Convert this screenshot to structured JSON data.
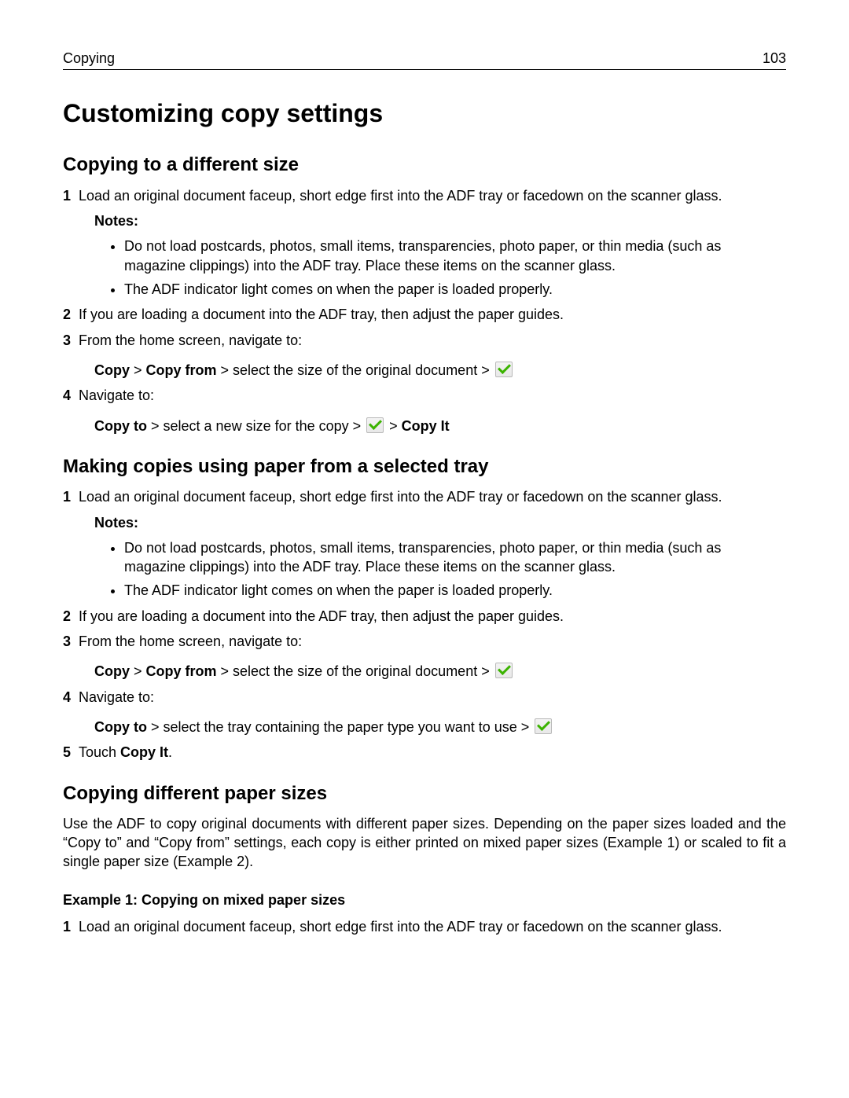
{
  "header": {
    "left": "Copying",
    "right": "103"
  },
  "title": "Customizing copy settings",
  "sectionA": {
    "heading": "Copying to a different size",
    "step1": "Load an original document faceup, short edge first into the ADF tray or facedown on the scanner glass.",
    "notesLabel": "Notes:",
    "note1": "Do not load postcards, photos, small items, transparencies, photo paper, or thin media (such as magazine clippings) into the ADF tray. Place these items on the scanner glass.",
    "note2": "The ADF indicator light comes on when the paper is loaded properly.",
    "step2": "If you are loading a document into the ADF tray, then adjust the paper guides.",
    "step3": "From the home screen, navigate to:",
    "path3_a": "Copy",
    "path3_gt1": " > ",
    "path3_b": "Copy from",
    "path3_rest": " > select the size of the original document > ",
    "step4": "Navigate to:",
    "path4_a": "Copy to",
    "path4_rest": " > select a new size for the copy > ",
    "path4_gt2": " > ",
    "path4_end": "Copy It"
  },
  "sectionB": {
    "heading": "Making copies using paper from a selected tray",
    "step1": "Load an original document faceup, short edge first into the ADF tray or facedown on the scanner glass.",
    "notesLabel": "Notes:",
    "note1": "Do not load postcards, photos, small items, transparencies, photo paper, or thin media (such as magazine clippings) into the ADF tray. Place these items on the scanner glass.",
    "note2": "The ADF indicator light comes on when the paper is loaded properly.",
    "step2": "If you are loading a document into the ADF tray, then adjust the paper guides.",
    "step3": "From the home screen, navigate to:",
    "path3_a": "Copy",
    "path3_gt1": " > ",
    "path3_b": "Copy from",
    "path3_rest": " > select the size of the original document > ",
    "step4": "Navigate to:",
    "path4_a": "Copy to",
    "path4_rest": " > select the tray containing the paper type you want to use > ",
    "step5_pre": "Touch ",
    "step5_b": "Copy It",
    "step5_post": "."
  },
  "sectionC": {
    "heading": "Copying different paper sizes",
    "intro": "Use the ADF to copy original documents with different paper sizes. Depending on the paper sizes loaded and the “Copy to” and “Copy from” settings, each copy is either printed on mixed paper sizes (Example 1) or scaled to fit a single paper size (Example 2).",
    "example1Heading": "Example 1: Copying on mixed paper sizes",
    "step1": "Load an original document faceup, short edge first into the ADF tray or facedown on the scanner glass."
  },
  "nums": {
    "n1": "1",
    "n2": "2",
    "n3": "3",
    "n4": "4",
    "n5": "5"
  }
}
